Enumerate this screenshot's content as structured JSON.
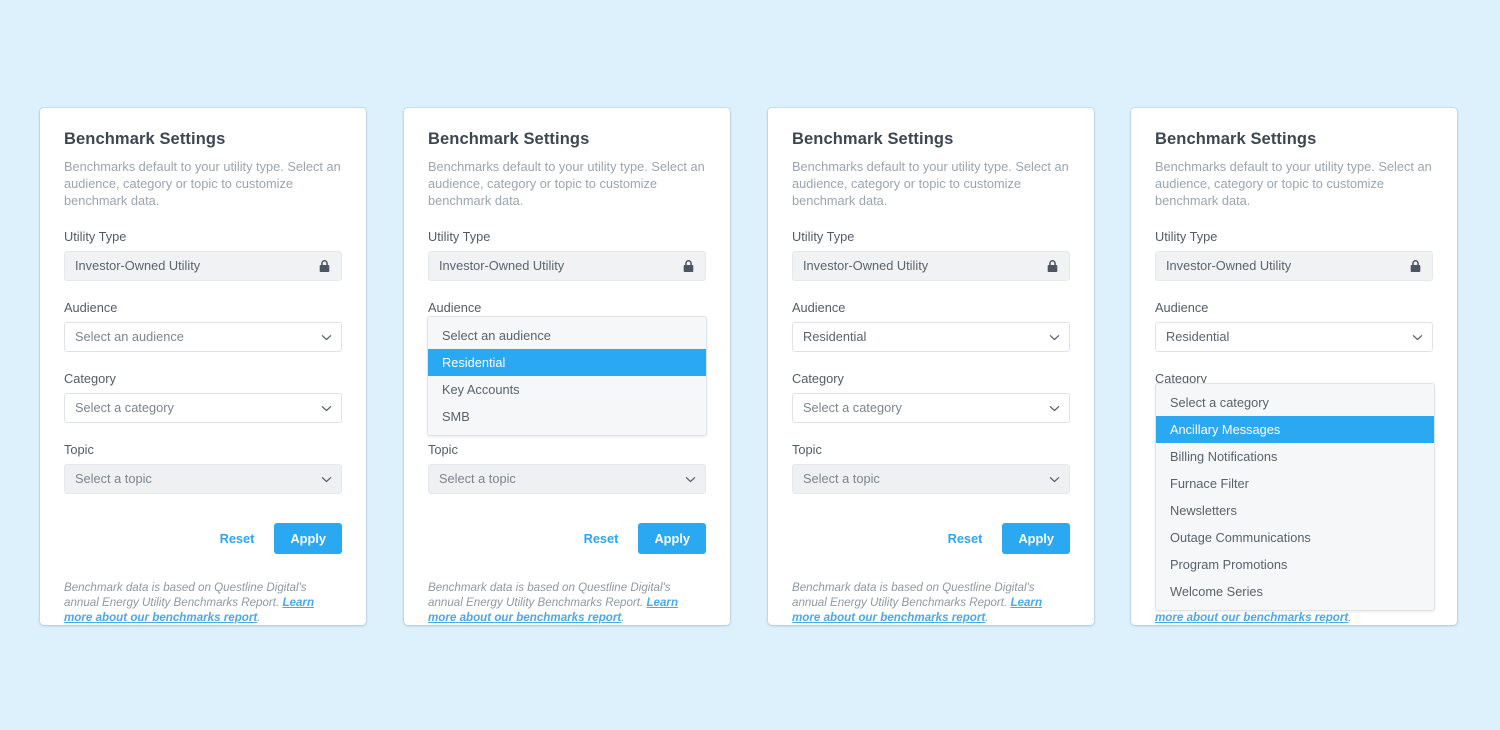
{
  "background_color": "#ddf1fd",
  "accent_color": "#2aa8f2",
  "card": {
    "title": "Benchmark Settings",
    "description": "Benchmarks default to your utility type. Select an audience, category or topic to customize benchmark data.",
    "labels": {
      "utility_type": "Utility Type",
      "audience": "Audience",
      "category": "Category",
      "topic": "Topic"
    },
    "placeholders": {
      "audience": "Select an audience",
      "category": "Select a category",
      "topic": "Select a topic"
    },
    "utility_type_value": "Investor-Owned Utility",
    "lock_icon": "lock-icon",
    "chevron_icon": "chevron-down-icon",
    "buttons": {
      "reset": "Reset",
      "apply": "Apply"
    },
    "footnote": {
      "text_before": "Benchmark data is based on Questline Digital's annual Energy Utility Benchmarks Report. ",
      "link": "Learn more about our benchmarks report",
      "text_after": "."
    }
  },
  "options": {
    "audience": [
      "Select an audience",
      "Residential",
      "Key Accounts",
      "SMB"
    ],
    "category": [
      "Select a category",
      "Ancillary Messages",
      "Billing Notifications",
      "Furnace Filter",
      "Newsletters",
      "Outage Communications",
      "Program Promotions",
      "Welcome Series"
    ]
  },
  "panels": [
    {
      "id": "panel-1",
      "state": "initial",
      "audience_value": "Select an audience",
      "category_value": "Select a category",
      "topic_value": "Select a topic"
    },
    {
      "id": "panel-2",
      "state": "audience-dropdown-open",
      "audience_value": "Select an audience",
      "category_value": "Select a category",
      "topic_value": "Select a topic",
      "open_dropdown": "audience",
      "highlighted_option": "Residential"
    },
    {
      "id": "panel-3",
      "state": "audience-selected",
      "audience_value": "Residential",
      "category_value": "Select a category",
      "topic_value": "Select a topic"
    },
    {
      "id": "panel-4",
      "state": "category-dropdown-open",
      "audience_value": "Residential",
      "category_value": "Select a category",
      "topic_value": "Select a topic",
      "open_dropdown": "category",
      "highlighted_option": "Ancillary Messages"
    }
  ]
}
